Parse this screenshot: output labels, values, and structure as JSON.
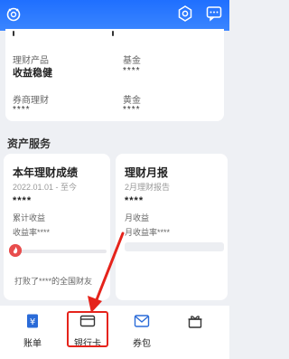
{
  "header": {
    "logo_icon": "app-logo-icon",
    "settings_icon": "settings-icon",
    "message_icon": "message-icon"
  },
  "top_card": {
    "products": [
      {
        "label": "理财产品",
        "value": "收益稳健"
      },
      {
        "label": "基金",
        "value": ""
      },
      {
        "label": "券商理财",
        "value": ""
      },
      {
        "label": "黄金",
        "value": ""
      }
    ],
    "masked": "****"
  },
  "asset_services": {
    "title": "资产服务",
    "annual": {
      "title": "本年理财成绩",
      "date_range": "2022.01.01 - 至今",
      "amount": "****",
      "income_label": "累计收益",
      "rate_label": "收益率****",
      "footer": "打败了****的全国财友",
      "beat_fraction": 0.03
    },
    "monthly": {
      "title": "理财月报",
      "subtitle": "2月理财报告",
      "amount": "****",
      "income_label": "月收益",
      "rate_label": "月收益率****"
    }
  },
  "bottom_nav": {
    "items": [
      {
        "label": "账单",
        "icon": "bill-icon"
      },
      {
        "label": "银行卡",
        "icon": "bank-card-icon"
      },
      {
        "label": "券包",
        "icon": "coupon-icon"
      },
      {
        "label": "",
        "icon": "gift-icon"
      }
    ],
    "highlighted": "银行卡"
  },
  "colors": {
    "header_blue": "#2a78ff",
    "highlight_red": "#e5231b",
    "accent_red": "#e84d4d"
  }
}
